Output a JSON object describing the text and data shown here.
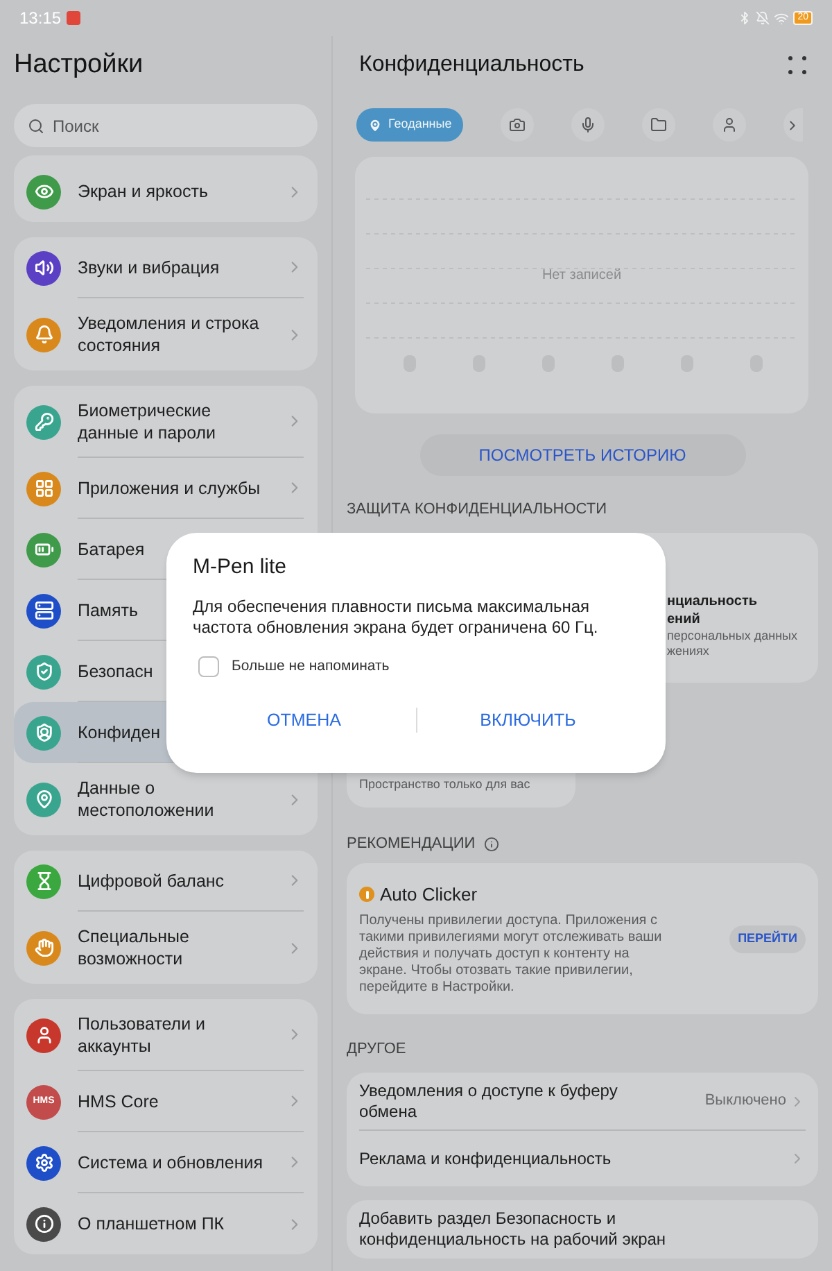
{
  "status_bar": {
    "time": "13:15",
    "battery": "20"
  },
  "sidebar": {
    "title": "Настройки",
    "search": {
      "placeholder": "Поиск"
    },
    "groups": [
      [
        {
          "color": "#3f9a4a",
          "label": "Экран и яркость",
          "selected": false
        }
      ],
      [
        {
          "color": "#5b3fc4",
          "label": "Звуки и вибрация",
          "selected": false
        },
        {
          "color": "#d9891c",
          "label": "Уведомления и строка состояния",
          "selected": false
        }
      ],
      [
        {
          "color": "#3aa58f",
          "label": "Биометрические данные и пароли",
          "selected": false
        },
        {
          "color": "#d9891c",
          "label": "Приложения и службы",
          "selected": false
        },
        {
          "color": "#3f9a4a",
          "label": "Батарея",
          "selected": false
        },
        {
          "color": "#1f4fc8",
          "label": "Память",
          "selected": false
        },
        {
          "color": "#3aa58f",
          "label": "Безопасн",
          "selected": false
        },
        {
          "color": "#3aa58f",
          "label": "Конфиден",
          "selected": true
        },
        {
          "color": "#3aa58f",
          "label": "Данные о местоположении",
          "selected": false
        }
      ],
      [
        {
          "color": "#3aa83f",
          "label": "Цифровой баланс",
          "selected": false
        },
        {
          "color": "#d9891c",
          "label": "Специальные возможности",
          "selected": false
        }
      ],
      [
        {
          "color": "#c8372c",
          "label": "Пользователи и аккаунты",
          "selected": false
        },
        {
          "icon_text": "HMS",
          "color": "#c24b4b",
          "label": "HMS Core",
          "selected": false
        },
        {
          "color": "#1f4fc8",
          "label": "Система и обновления",
          "selected": false
        },
        {
          "color": "#4a4a4a",
          "label": "О планшетном ПК",
          "selected": false
        }
      ]
    ]
  },
  "panel": {
    "title": "Конфиденциальность",
    "tabs": [
      {
        "kind": "location",
        "label": "Геоданные",
        "selected": true
      },
      {
        "kind": "camera",
        "selected": false
      },
      {
        "kind": "mic",
        "selected": false
      },
      {
        "kind": "folder",
        "selected": false
      },
      {
        "kind": "contact",
        "selected": false
      },
      {
        "kind": "next",
        "selected": false
      }
    ],
    "chart": {
      "empty_text": "Нет записей"
    },
    "history_button": "ПОСМОТРЕТЬ ИСТОРИЮ",
    "protection": {
      "header": "ЗАЩИТА КОНФИДЕНЦИАЛЬНОСТИ",
      "card_title_lines": [
        "нциальность",
        "ений"
      ],
      "card_text_lines": [
        "персональных данных",
        "жениях"
      ],
      "space_text": "Пространство только для вас"
    },
    "recommendations": {
      "header": "РЕКОМЕНДАЦИИ",
      "title": "Auto Clicker",
      "text": "Получены привилегии доступа. Приложения с такими привилегиями могут отслеживать ваши действия и получать доступ к контенту на экране. Чтобы отозвать такие привилегии, перейдите в Настройки.",
      "button": "ПЕРЕЙТИ"
    },
    "other": {
      "header": "ДРУГОЕ",
      "rows": [
        {
          "label": "Уведомления о доступе к буферу обмена",
          "value": "Выключено"
        },
        {
          "label": "Реклама и конфиденциальность"
        }
      ],
      "shortcut": "Добавить раздел Безопасность и конфиденциальность на рабочий экран"
    }
  },
  "dialog": {
    "title": "M-Pen lite",
    "message": "Для обеспечения плавности письма максимальная частота обновления экрана будет ограничена 60 Гц.",
    "checkbox": {
      "label": "Больше не напоминать",
      "checked": false
    },
    "buttons": [
      "ОТМЕНА",
      "ВКЛЮЧИТЬ"
    ]
  }
}
